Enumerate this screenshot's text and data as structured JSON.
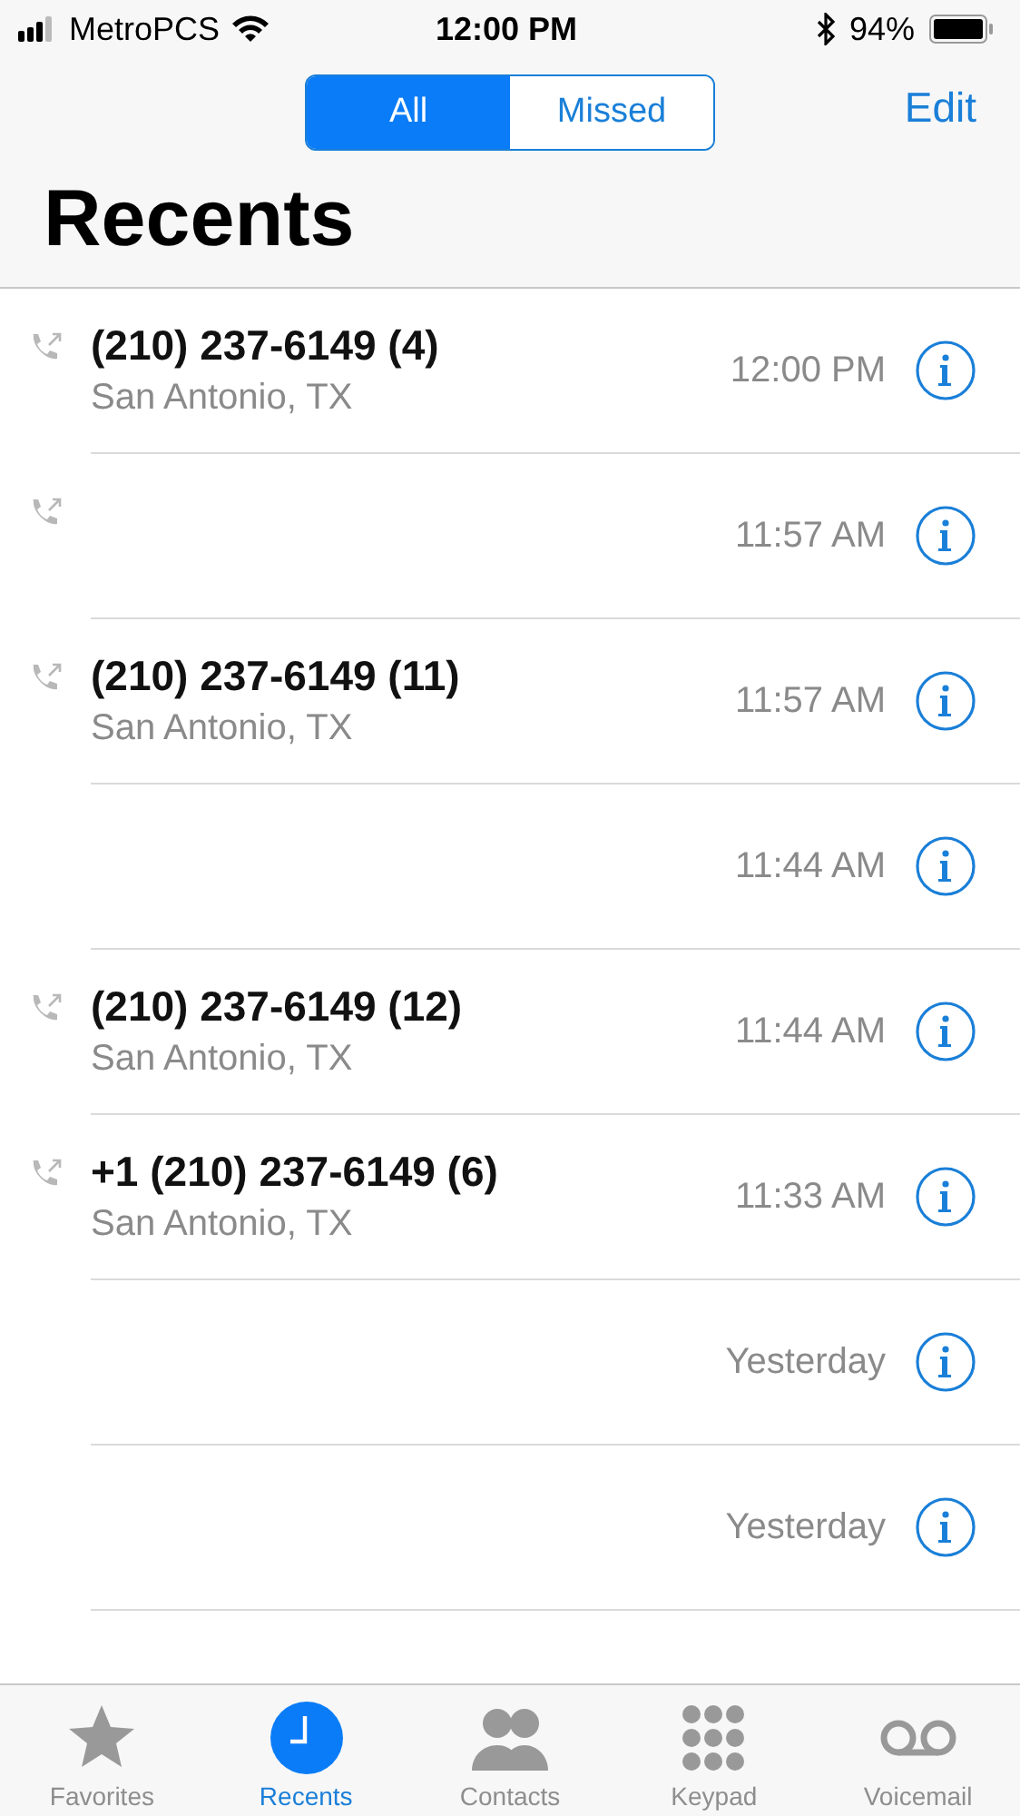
{
  "status_bar": {
    "carrier": "MetroPCS",
    "time": "12:00 PM",
    "battery": "94%"
  },
  "segments": [
    {
      "label": "All",
      "selected": true
    },
    {
      "label": "Missed",
      "selected": false
    }
  ],
  "edit_button": "Edit",
  "title": "Recents",
  "calls": [
    {
      "outgoing": true,
      "name": "(210) 237-6149 (4)",
      "location": "San Antonio, TX",
      "time": "12:00 PM"
    },
    {
      "outgoing": true,
      "time": "11:57 AM"
    },
    {
      "outgoing": true,
      "name": "(210) 237-6149 (11)",
      "location": "San Antonio, TX",
      "time": "11:57 AM"
    },
    {
      "outgoing": false,
      "time": "11:44 AM"
    },
    {
      "outgoing": true,
      "name": "(210) 237-6149 (12)",
      "location": "San Antonio, TX",
      "time": "11:44 AM"
    },
    {
      "outgoing": true,
      "name": "+1 (210) 237-6149 (6)",
      "location": "San Antonio, TX",
      "time": "11:33 AM"
    },
    {
      "outgoing": false,
      "time": "Yesterday"
    },
    {
      "outgoing": false,
      "time": "Yesterday"
    }
  ],
  "tab_bar": [
    {
      "kind": "star",
      "label": "Favorites",
      "selected": false
    },
    {
      "kind": "clock",
      "label": "Recents",
      "selected": true
    },
    {
      "kind": "people",
      "label": "Contacts",
      "selected": false
    },
    {
      "kind": "keypad",
      "label": "Keypad",
      "selected": false
    },
    {
      "kind": "voicemail",
      "label": "Voicemail",
      "selected": false
    }
  ]
}
